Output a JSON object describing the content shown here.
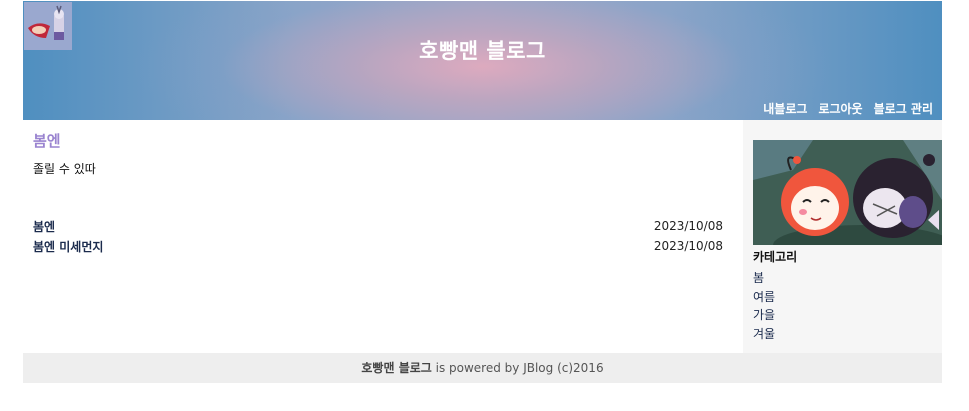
{
  "header": {
    "title": "호빵맨 블로그",
    "nav": [
      "내블로그",
      "로그아웃",
      "블로그 관리"
    ]
  },
  "post": {
    "title": "봄엔",
    "body": "졸릴 수 있따"
  },
  "posts": [
    {
      "title": "봄엔",
      "date": "2023/10/08"
    },
    {
      "title": "봄엔 미세먼지",
      "date": "2023/10/08"
    }
  ],
  "sidebar": {
    "category_heading": "카테고리",
    "categories": [
      "봄",
      "여름",
      "가을",
      "겨울"
    ]
  },
  "footer": {
    "brand": "호빵맨 블로그",
    "text": " is powered by JBlog (c)2016"
  },
  "colors": {
    "header_edge": "#4f8fc0",
    "header_center": "#e0aabe",
    "post_title": "#9a84d0",
    "link": "#1b2b4d"
  }
}
